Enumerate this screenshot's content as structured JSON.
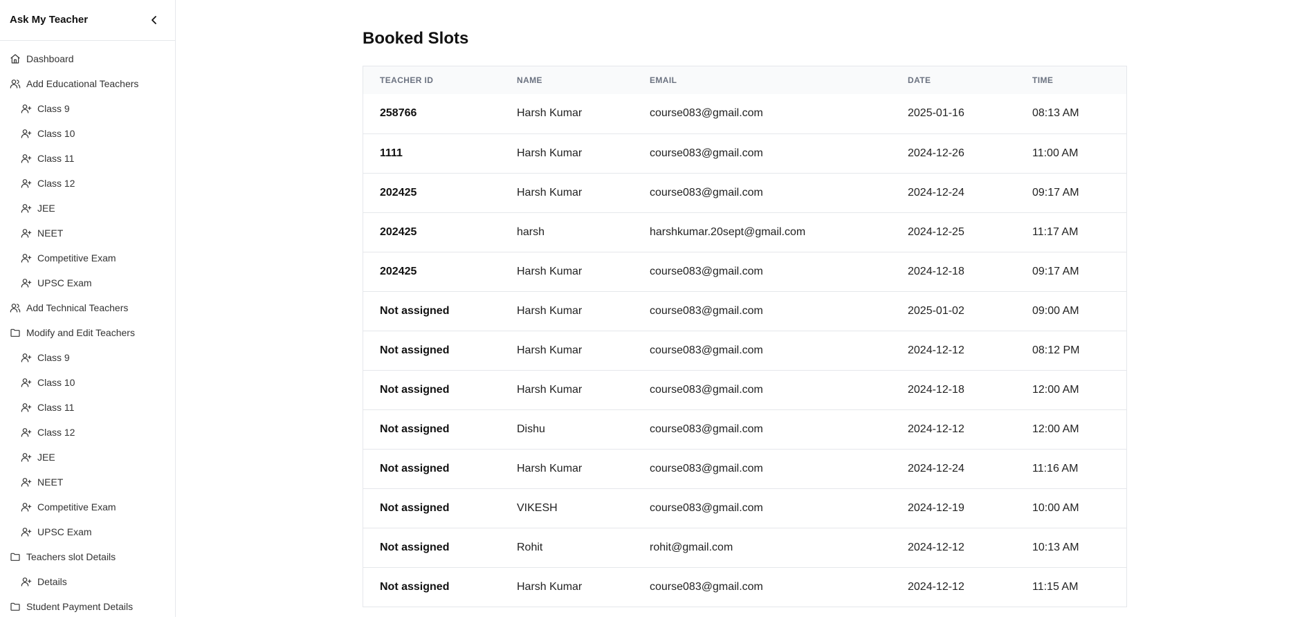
{
  "sidebar": {
    "brand": "Ask My Teacher",
    "nav": [
      {
        "label": "Dashboard",
        "level": "top",
        "icon": "home-icon"
      },
      {
        "label": "Add Educational Teachers",
        "level": "top",
        "icon": "users-icon"
      },
      {
        "label": "Class 9",
        "level": "sub",
        "icon": "user-plus-icon"
      },
      {
        "label": "Class 10",
        "level": "sub",
        "icon": "user-plus-icon"
      },
      {
        "label": "Class 11",
        "level": "sub",
        "icon": "user-plus-icon"
      },
      {
        "label": "Class 12",
        "level": "sub",
        "icon": "user-plus-icon"
      },
      {
        "label": "JEE",
        "level": "sub",
        "icon": "user-plus-icon"
      },
      {
        "label": "NEET",
        "level": "sub",
        "icon": "user-plus-icon"
      },
      {
        "label": "Competitive Exam",
        "level": "sub",
        "icon": "user-plus-icon"
      },
      {
        "label": "UPSC Exam",
        "level": "sub",
        "icon": "user-plus-icon"
      },
      {
        "label": "Add Technical Teachers",
        "level": "top",
        "icon": "users-icon"
      },
      {
        "label": "Modify and Edit Teachers",
        "level": "top",
        "icon": "folder-icon"
      },
      {
        "label": "Class 9",
        "level": "sub",
        "icon": "user-plus-icon"
      },
      {
        "label": "Class 10",
        "level": "sub",
        "icon": "user-plus-icon"
      },
      {
        "label": "Class 11",
        "level": "sub",
        "icon": "user-plus-icon"
      },
      {
        "label": "Class 12",
        "level": "sub",
        "icon": "user-plus-icon"
      },
      {
        "label": "JEE",
        "level": "sub",
        "icon": "user-plus-icon"
      },
      {
        "label": "NEET",
        "level": "sub",
        "icon": "user-plus-icon"
      },
      {
        "label": "Competitive Exam",
        "level": "sub",
        "icon": "user-plus-icon"
      },
      {
        "label": "UPSC Exam",
        "level": "sub",
        "icon": "user-plus-icon"
      },
      {
        "label": "Teachers slot Details",
        "level": "top",
        "icon": "folder-icon"
      },
      {
        "label": "Details",
        "level": "sub",
        "icon": "user-plus-icon"
      },
      {
        "label": "Student Payment Details",
        "level": "top",
        "icon": "folder-icon"
      }
    ]
  },
  "main": {
    "title": "Booked Slots",
    "columns": [
      "TEACHER ID",
      "NAME",
      "EMAIL",
      "DATE",
      "TIME"
    ],
    "rows": [
      [
        "258766",
        "Harsh Kumar",
        "course083@gmail.com",
        "2025-01-16",
        "08:13 AM"
      ],
      [
        "1111",
        "Harsh Kumar",
        "course083@gmail.com",
        "2024-12-26",
        "11:00 AM"
      ],
      [
        "202425",
        "Harsh Kumar",
        "course083@gmail.com",
        "2024-12-24",
        "09:17 AM"
      ],
      [
        "202425",
        "harsh",
        "harshkumar.20sept@gmail.com",
        "2024-12-25",
        "11:17 AM"
      ],
      [
        "202425",
        "Harsh Kumar",
        "course083@gmail.com",
        "2024-12-18",
        "09:17 AM"
      ],
      [
        "Not assigned",
        "Harsh Kumar",
        "course083@gmail.com",
        "2025-01-02",
        "09:00 AM"
      ],
      [
        "Not assigned",
        "Harsh Kumar",
        "course083@gmail.com",
        "2024-12-12",
        "08:12 PM"
      ],
      [
        "Not assigned",
        "Harsh Kumar",
        "course083@gmail.com",
        "2024-12-18",
        "12:00 AM"
      ],
      [
        "Not assigned",
        "Dishu",
        "course083@gmail.com",
        "2024-12-12",
        "12:00 AM"
      ],
      [
        "Not assigned",
        "Harsh Kumar",
        "course083@gmail.com",
        "2024-12-24",
        "11:16 AM"
      ],
      [
        "Not assigned",
        "VIKESH",
        "course083@gmail.com",
        "2024-12-19",
        "10:00 AM"
      ],
      [
        "Not assigned",
        "Rohit",
        "rohit@gmail.com",
        "2024-12-12",
        "10:13 AM"
      ],
      [
        "Not assigned",
        "Harsh Kumar",
        "course083@gmail.com",
        "2024-12-12",
        "11:15 AM"
      ]
    ]
  }
}
